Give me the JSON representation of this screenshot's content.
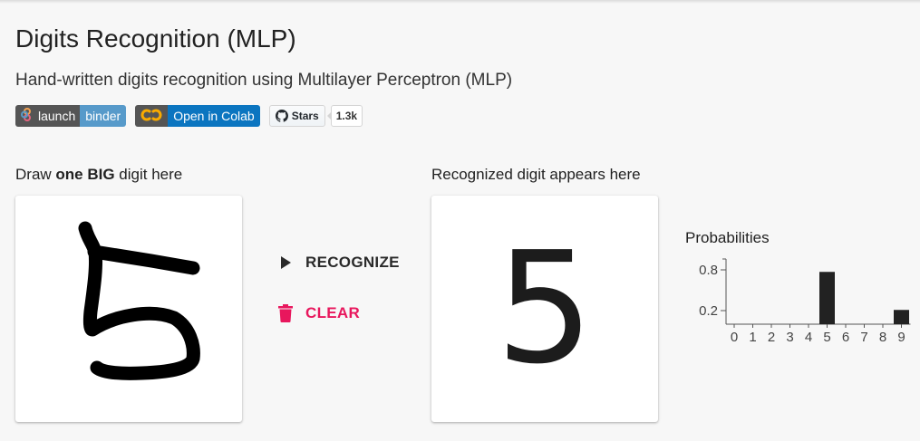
{
  "header": {
    "title": "Digits Recognition (MLP)",
    "subtitle": "Hand-written digits recognition using Multilayer Perceptron (MLP)"
  },
  "badges": {
    "binder": {
      "left": "launch",
      "right": "binder",
      "icon": "binder-logo-icon",
      "color": "#579aca"
    },
    "colab": {
      "left": "",
      "right": "Open in Colab",
      "icon": "colab-logo-icon",
      "color": "#0b75c0"
    },
    "github": {
      "label": "Stars",
      "count": "1.3k",
      "icon": "github-logo-icon"
    }
  },
  "draw_panel": {
    "label_prefix": "Draw ",
    "label_bold": "one BIG",
    "label_suffix": " digit here"
  },
  "actions": {
    "recognize": {
      "label": "RECOGNIZE",
      "icon": "play-icon",
      "color": "#2a2a2a"
    },
    "clear": {
      "label": "CLEAR",
      "icon": "trash-icon",
      "color": "#e8175d"
    }
  },
  "result_panel": {
    "label": "Recognized digit appears here",
    "digit": "5"
  },
  "probabilities": {
    "title": "Probabilities"
  },
  "chart_data": {
    "type": "bar",
    "title": "Probabilities",
    "categories": [
      "0",
      "1",
      "2",
      "3",
      "4",
      "5",
      "6",
      "7",
      "8",
      "9"
    ],
    "values": [
      0,
      0,
      0,
      0,
      0,
      0.77,
      0,
      0,
      0,
      0.21
    ],
    "ytick_labels": [
      "0.8",
      "0.2"
    ],
    "ytick_values": [
      0.8,
      0.2
    ],
    "ylim": [
      0,
      1.0
    ],
    "grid": false,
    "bar_color": "#222222"
  }
}
